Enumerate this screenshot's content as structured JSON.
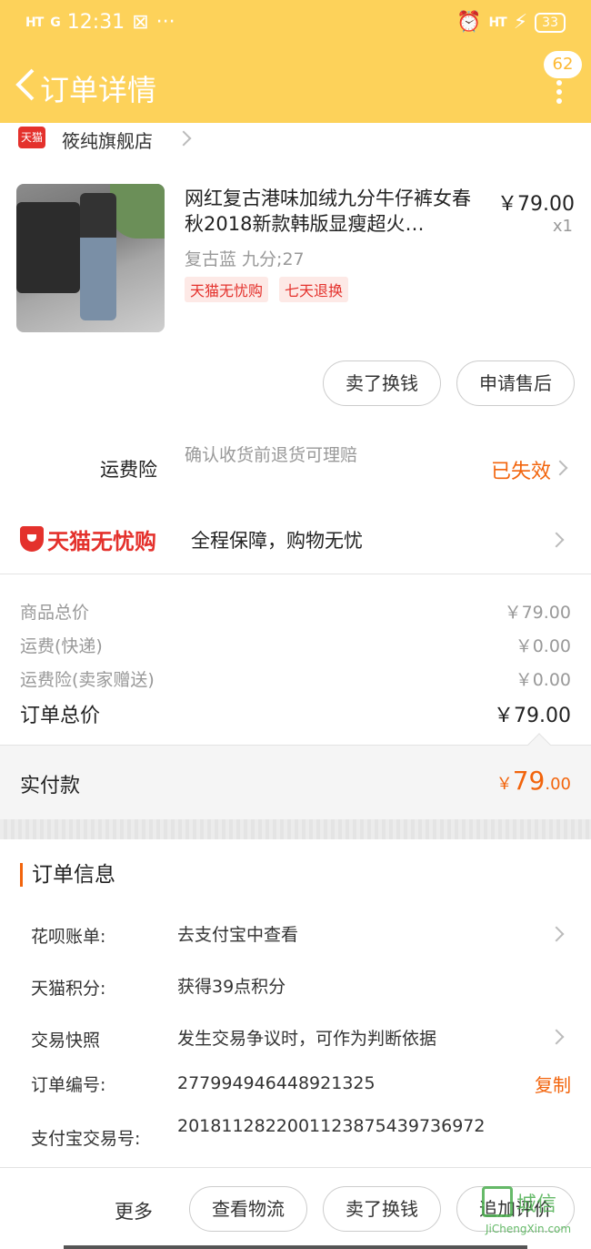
{
  "status_bar": {
    "signal_1": "HT",
    "signal_2": "G",
    "time": "12:31",
    "sim_indicator": "⊠",
    "overflow": "···",
    "right_signal": "HT",
    "battery": "33"
  },
  "nav": {
    "title": "订单详情",
    "message_count": "62"
  },
  "shop": {
    "logo_text": "天猫",
    "name": "筱纯旗舰店"
  },
  "product": {
    "title": "网红复古港味加绒九分牛仔裤女春秋2018新款韩版显瘦超火…",
    "price": "￥79.00",
    "quantity": "x1",
    "sku": "复古蓝 九分;27",
    "tags": [
      "天猫无忧购",
      "七天退换"
    ]
  },
  "product_actions": {
    "sell_exchange": "卖了换钱",
    "after_sale": "申请售后"
  },
  "freight_insurance": {
    "label": "运费险",
    "description": "确认收货前退货可理赔",
    "status": "已失效"
  },
  "assurance": {
    "brand": "天猫无忧购",
    "text": "全程保障，购物无忧"
  },
  "price_summary": {
    "goods_total_label": "商品总价",
    "goods_total_value": "￥79.00",
    "shipping_label": "运费(快递)",
    "shipping_value": "￥0.00",
    "insurance_label": "运费险(卖家赠送)",
    "insurance_value": "￥0.00",
    "order_total_label": "订单总价",
    "order_total_value": "￥79.00"
  },
  "payment": {
    "label": "实付款",
    "currency": "￥",
    "amount_int": "79",
    "amount_dec": ".00"
  },
  "order_info": {
    "heading": "订单信息",
    "rows": [
      {
        "key": "花呗账单:",
        "value": "去支付宝中查看"
      },
      {
        "key": "天猫积分:",
        "value": "获得39点积分"
      },
      {
        "key": "交易快照",
        "value": "发生交易争议时，可作为判断依据"
      },
      {
        "key": "订单编号:",
        "value": "277994946448921325"
      },
      {
        "key": "支付宝交易号:",
        "value": "2018112822001123875439736972"
      }
    ],
    "copy_label": "复制"
  },
  "bottom_bar": {
    "more": "更多",
    "logistics": "查看物流",
    "sell_exchange": "卖了换钱",
    "add_review": "追加评价"
  },
  "watermark": {
    "text": "城信",
    "sub": "JiChengXin.com"
  }
}
